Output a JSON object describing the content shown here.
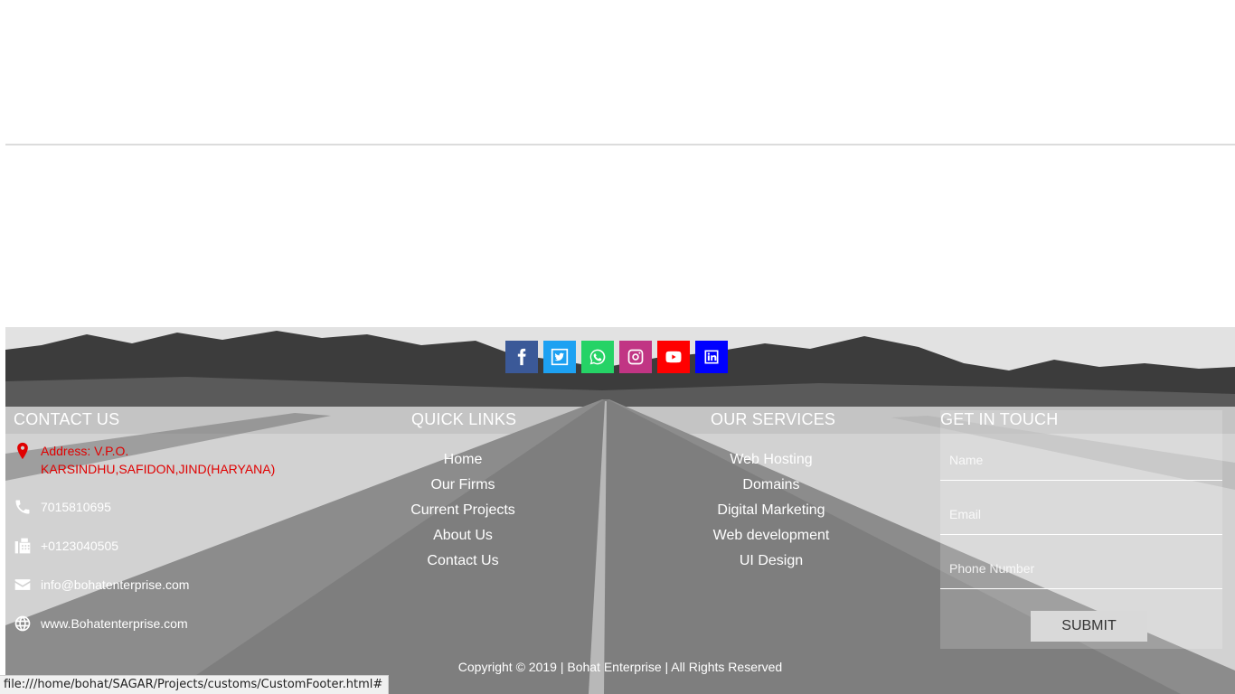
{
  "social": [
    {
      "name": "facebook-icon",
      "color": "#3b5998"
    },
    {
      "name": "twitter-icon",
      "color": "#1da1f2"
    },
    {
      "name": "whatsapp-icon",
      "color": "#25d366"
    },
    {
      "name": "instagram-icon",
      "color": "#c13584"
    },
    {
      "name": "youtube-icon",
      "color": "#ff0000"
    },
    {
      "name": "linkedin-icon",
      "color": "#0000ff"
    }
  ],
  "contact": {
    "title": "CONTACT US",
    "address_line1": "Address: V.P.O.",
    "address_line2": "KARSINDHU,SAFIDON,JIND(HARYANA)",
    "phone": "7015810695",
    "fax": "+0123040505",
    "email": "info@bohatenterprise.com",
    "website": "www.Bohatenterprise.com"
  },
  "quick_links": {
    "title": "QUICK LINKS",
    "items": [
      "Home",
      "Our Firms",
      "Current Projects",
      "About Us",
      "Contact Us"
    ]
  },
  "services": {
    "title": "OUR SERVICES",
    "items": [
      "Web Hosting",
      "Domains",
      "Digital Marketing",
      "Web development",
      "UI Design"
    ]
  },
  "get_in_touch": {
    "title": "GET IN TOUCH",
    "name_placeholder": "Name",
    "email_placeholder": "Email",
    "phone_placeholder": "Phone Number",
    "submit_label": "SUBMIT"
  },
  "copyright": "Copyright © 2019 | Bohat Enterprise | All Rights Reserved",
  "status_url": "file:///home/bohat/SAGAR/Projects/customs/CustomFooter.html#"
}
